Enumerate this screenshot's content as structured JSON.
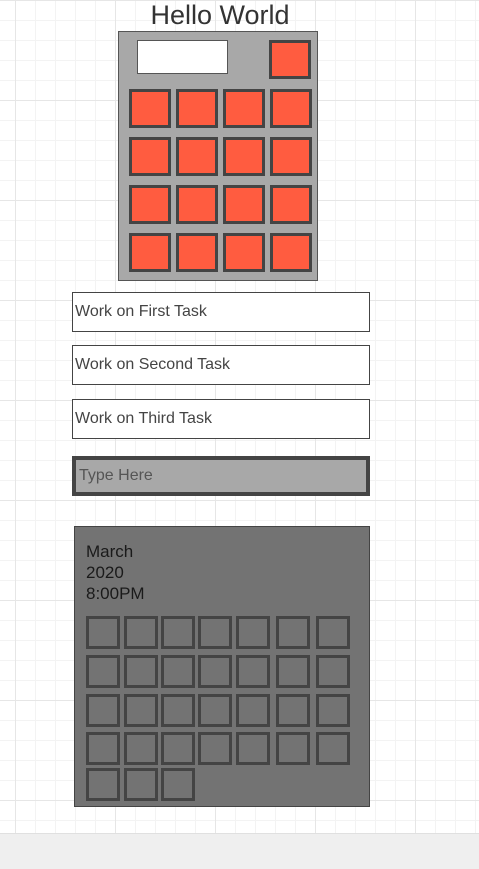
{
  "header": {
    "title": "Hello World"
  },
  "calculator": {
    "display_value": ""
  },
  "tasks": [
    {
      "label": "Work on First Task"
    },
    {
      "label": "Work on Second Task"
    },
    {
      "label": "Work on Third Task"
    }
  ],
  "input": {
    "placeholder": "Type Here",
    "value": ""
  },
  "calendar": {
    "month": "March",
    "year": "2020",
    "time": "8:00PM",
    "day_count": 31
  },
  "colors": {
    "key": "#ff5c40",
    "calculator_body": "#a8a8a8",
    "calendar_body": "#737373",
    "border": "#444444"
  }
}
